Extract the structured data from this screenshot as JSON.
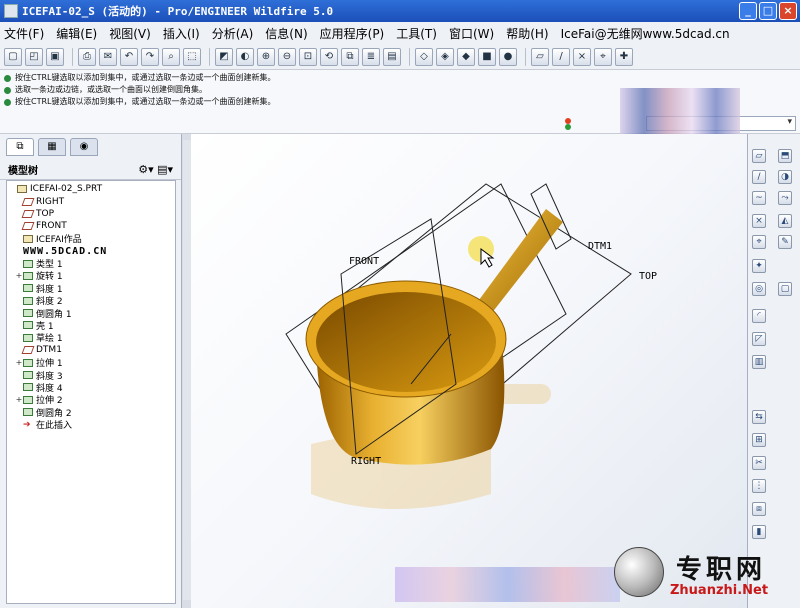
{
  "window": {
    "title": "ICEFAI-02_S (活动的) - Pro/ENGINEER Wildfire 5.0"
  },
  "menu": [
    "文件(F)",
    "编辑(E)",
    "视图(V)",
    "插入(I)",
    "分析(A)",
    "信息(N)",
    "应用程序(P)",
    "工具(T)",
    "窗口(W)",
    "帮助(H)"
  ],
  "menu_brand": "IceFai@无维网www.5dcad.cn",
  "messages": [
    "按住CTRL键选取以添加到集中，或通过选取一条边或一个曲面创建新集。",
    "选取一条边或边链，或选取一个曲面以创建倒圆角集。",
    "按住CTRL键选取以添加到集中，或通过选取一条边或一个曲面创建新集。"
  ],
  "tree": {
    "header": "模型树",
    "nodes": [
      {
        "label": "ICEFAI-02_S.PRT",
        "icon": "part",
        "exp": ""
      },
      {
        "label": "RIGHT",
        "icon": "plane",
        "exp": ""
      },
      {
        "label": "TOP",
        "icon": "plane",
        "exp": ""
      },
      {
        "label": "FRONT",
        "icon": "plane",
        "exp": ""
      },
      {
        "label": "ICEFAI作品",
        "icon": "csys",
        "exp": ""
      },
      {
        "label": "WWW.5DCAD.CN",
        "icon": "none",
        "exp": "",
        "wm": true
      },
      {
        "label": "类型 1",
        "icon": "feat",
        "exp": ""
      },
      {
        "label": "旋转 1",
        "icon": "feat",
        "exp": "+"
      },
      {
        "label": "斜度 1",
        "icon": "feat",
        "exp": ""
      },
      {
        "label": "斜度 2",
        "icon": "feat",
        "exp": ""
      },
      {
        "label": "倒圆角 1",
        "icon": "feat",
        "exp": ""
      },
      {
        "label": "壳 1",
        "icon": "feat",
        "exp": ""
      },
      {
        "label": "草绘 1",
        "icon": "feat",
        "exp": ""
      },
      {
        "label": "DTM1",
        "icon": "plane",
        "exp": ""
      },
      {
        "label": "拉伸 1",
        "icon": "feat",
        "exp": "+"
      },
      {
        "label": "斜度 3",
        "icon": "feat",
        "exp": ""
      },
      {
        "label": "斜度 4",
        "icon": "feat",
        "exp": ""
      },
      {
        "label": "拉伸 2",
        "icon": "feat",
        "exp": "+"
      },
      {
        "label": "倒圆角 2",
        "icon": "feat",
        "exp": ""
      },
      {
        "label": "在此插入",
        "icon": "insert",
        "exp": ""
      }
    ]
  },
  "datum_labels": {
    "front": "FRONT",
    "right": "RIGHT",
    "top": "TOP",
    "dtm": "DTM1"
  },
  "watermark": {
    "cn": "专职网",
    "url": "Zhuanzhi.Net"
  },
  "colors": {
    "pot": "#d89a10",
    "pot_dark": "#8a5a00",
    "titlebar": "#1c4fb8"
  }
}
